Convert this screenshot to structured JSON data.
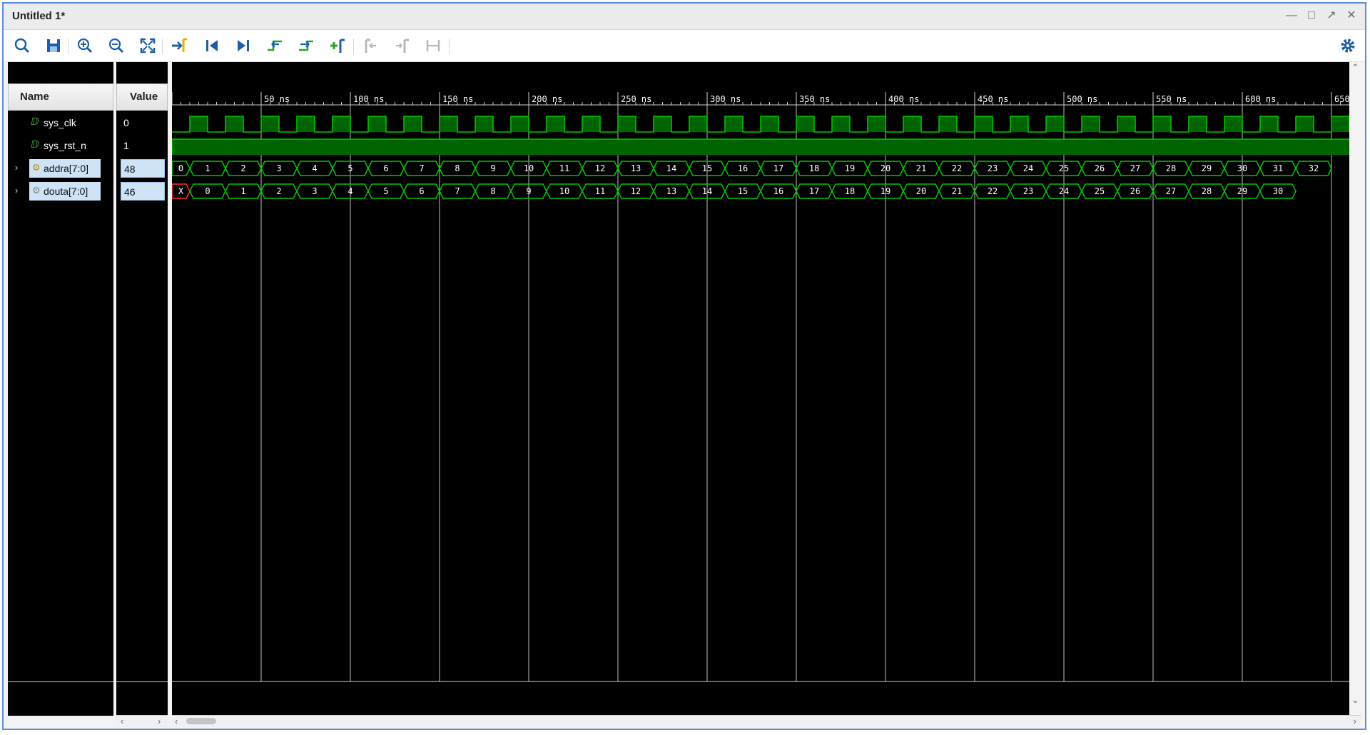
{
  "window": {
    "title": "Untitled 1*"
  },
  "columns": {
    "name": "Name",
    "value": "Value"
  },
  "signals": [
    {
      "name": "sys_clk",
      "value": "0",
      "type": "bit"
    },
    {
      "name": "sys_rst_n",
      "value": "1",
      "type": "bit"
    },
    {
      "name": "addra[7:0]",
      "value": "48",
      "type": "bus"
    },
    {
      "name": "douta[7:0]",
      "value": "46",
      "type": "bus"
    }
  ],
  "timeline": {
    "tick_labels": [
      "50 ns",
      "100 ns",
      "150 ns",
      "200 ns",
      "250 ns",
      "300 ns",
      "350 ns",
      "400 ns",
      "450 ns",
      "500 ns",
      "550 ns",
      "600 ns",
      "650 ns"
    ],
    "addra_values": [
      "0",
      "1",
      "2",
      "3",
      "4",
      "5",
      "6",
      "7",
      "8",
      "9",
      "10",
      "11",
      "12",
      "13",
      "14",
      "15",
      "16",
      "17",
      "18",
      "19",
      "20",
      "21",
      "22",
      "23",
      "24",
      "25",
      "26",
      "27",
      "28",
      "29",
      "30",
      "31",
      "32"
    ],
    "douta_values": [
      "X",
      "0",
      "1",
      "2",
      "3",
      "4",
      "5",
      "6",
      "7",
      "8",
      "9",
      "10",
      "11",
      "12",
      "13",
      "14",
      "15",
      "16",
      "17",
      "18",
      "19",
      "20",
      "21",
      "22",
      "23",
      "24",
      "25",
      "26",
      "27",
      "28",
      "29",
      "30"
    ]
  },
  "colors": {
    "wave": "#00c800",
    "wave_fill": "#006400",
    "undefined": "#ff3030",
    "grid": "#bdbdbd",
    "background": "#000000"
  },
  "toolbar": {
    "icons": [
      "search-icon",
      "save-icon",
      "zoom-in-icon",
      "zoom-out-icon",
      "zoom-fit-icon",
      "go-to-cursor-icon",
      "go-to-start-icon",
      "go-to-end-icon",
      "previous-transition-icon",
      "next-transition-icon",
      "add-marker-icon",
      "previous-marker-icon",
      "next-marker-icon",
      "swap-cursors-icon"
    ],
    "settings_icon": "gear-icon"
  }
}
